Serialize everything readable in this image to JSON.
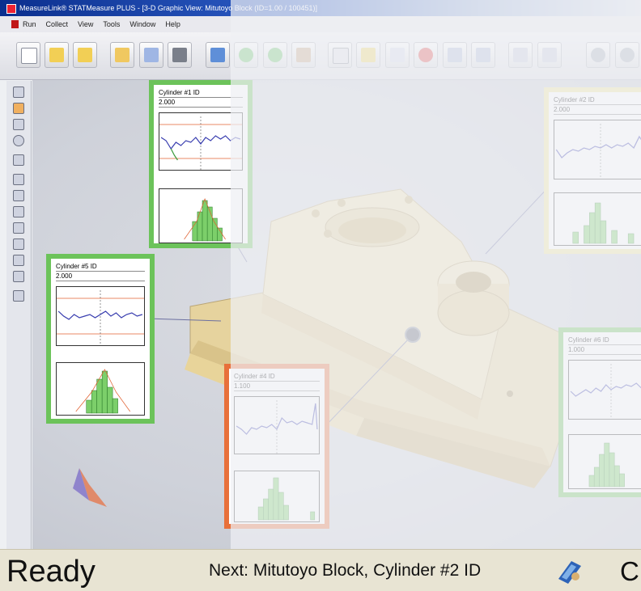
{
  "window": {
    "title": "MeasureLink® STATMeasure PLUS - [3-D Graphic View: Mitutoyo Block (ID=1.00 / 100451)]"
  },
  "menu": {
    "items": [
      "Run",
      "Collect",
      "View",
      "Tools",
      "Window",
      "Help"
    ]
  },
  "panels": {
    "p1": {
      "title": "Cylinder #1 ID",
      "value": "2.000"
    },
    "p2": {
      "title": "Cylinder #2 ID",
      "value": "2.000"
    },
    "p3": {
      "title": "Cylinder #4 ID",
      "value": "1.100"
    },
    "p4": {
      "title": "Cylinder #5 ID",
      "value": "2.000"
    },
    "p5": {
      "title": "Cylinder #6 ID",
      "value": "1.000"
    }
  },
  "status": {
    "state": "Ready",
    "next": "Next: Mitutoyo Block, Cylinder #2 ID",
    "trailing": "Cu"
  },
  "colors": {
    "green_border": "#6cc35a",
    "orange_border": "#e8703a",
    "yellow_border": "#efe69a",
    "part_fill": "#efdfb0",
    "run_line": "#3a3fb0"
  }
}
